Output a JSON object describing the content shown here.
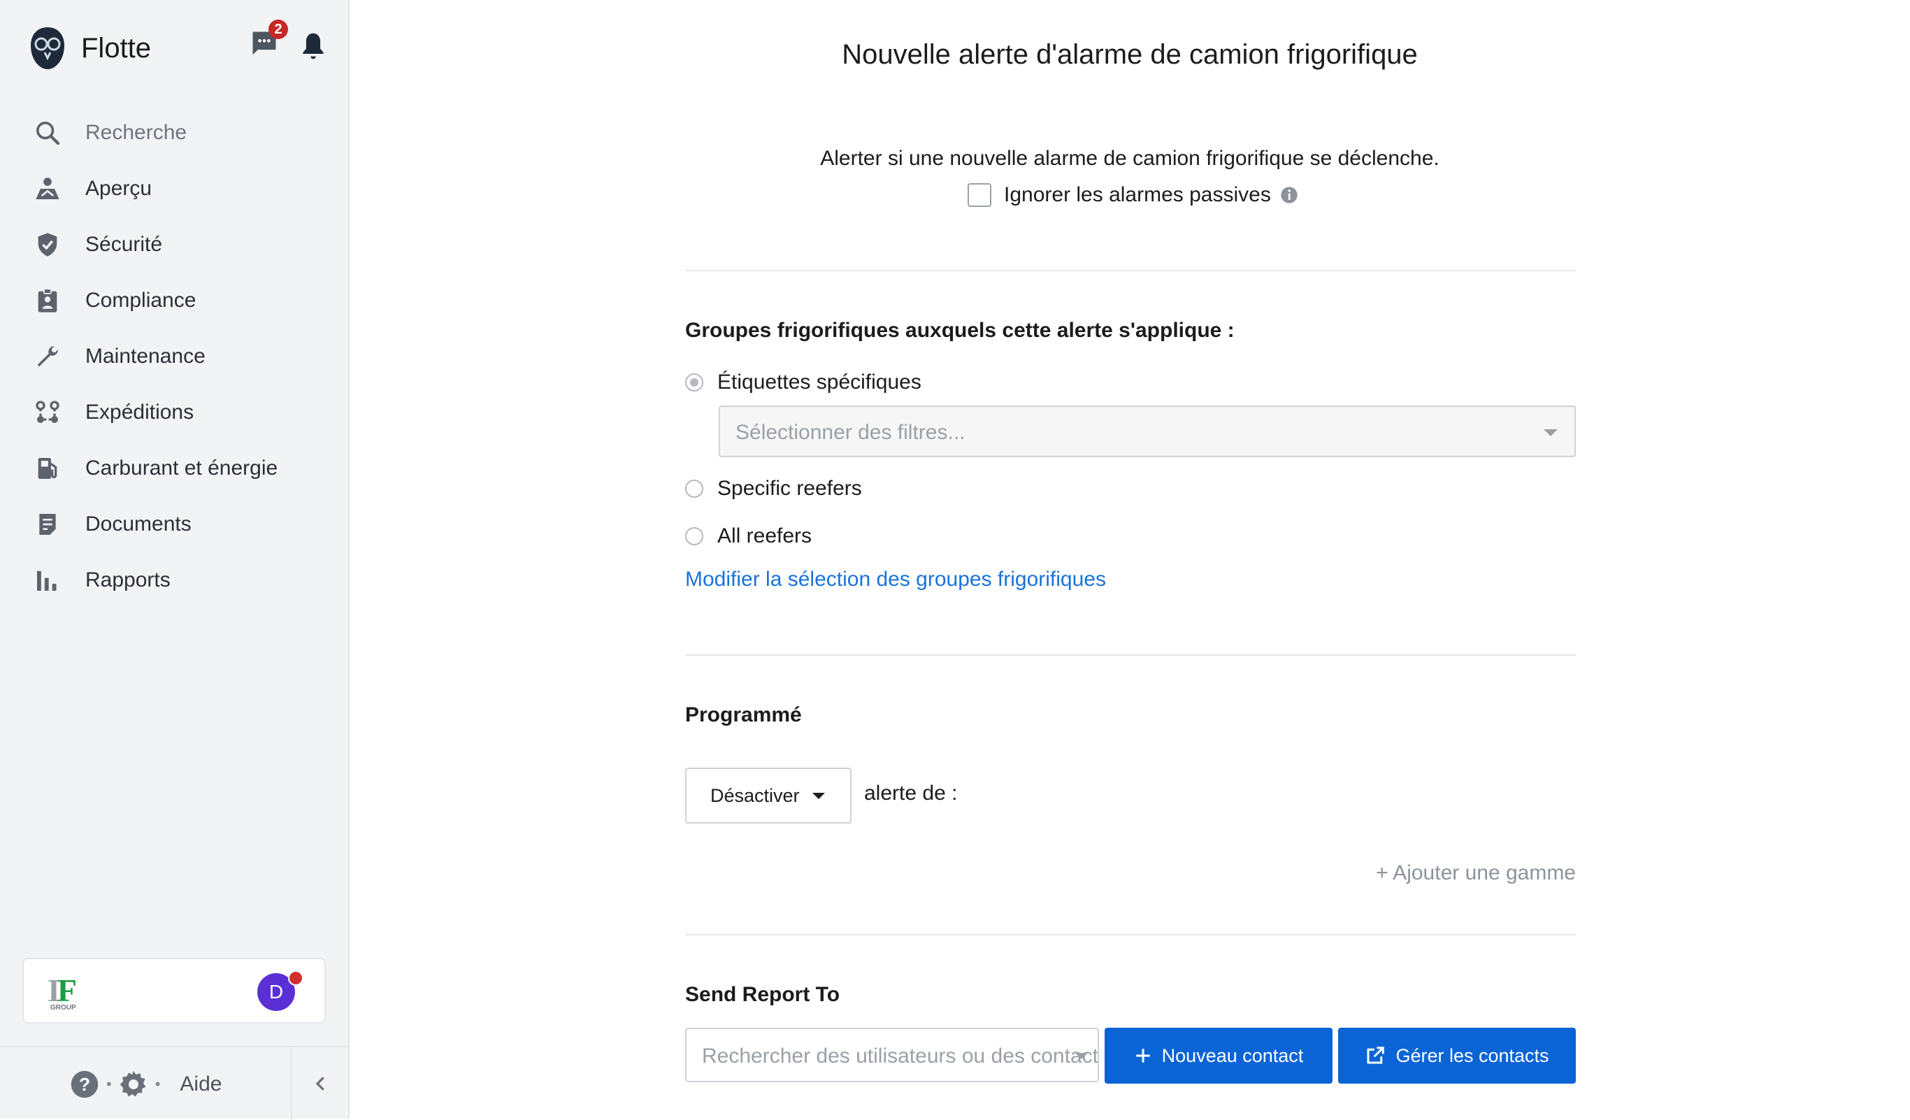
{
  "app": {
    "name": "Flotte"
  },
  "header": {
    "chat_badge_count": "2"
  },
  "search": {
    "label": "Recherche"
  },
  "nav": {
    "items": [
      {
        "label": "Aperçu",
        "icon": "map-person-icon"
      },
      {
        "label": "Sécurité",
        "icon": "shield-check-icon"
      },
      {
        "label": "Compliance",
        "icon": "clipboard-person-icon"
      },
      {
        "label": "Maintenance",
        "icon": "wrench-icon"
      },
      {
        "label": "Expéditions",
        "icon": "route-icon"
      },
      {
        "label": "Carburant et énergie",
        "icon": "fuel-pump-icon"
      },
      {
        "label": "Documents",
        "icon": "document-icon"
      },
      {
        "label": "Rapports",
        "icon": "bar-chart-icon"
      }
    ]
  },
  "org": {
    "avatar_initial": "D"
  },
  "footer": {
    "help_label": "Aide"
  },
  "page": {
    "title": "Nouvelle alerte d'alarme de camion frigorifique",
    "description": "Alerter si une nouvelle alarme de camion frigorifique se déclenche.",
    "ignore_passive_label": "Ignorer les alarmes passives"
  },
  "groups": {
    "title": "Groupes frigorifiques auxquels cette alerte s'applique :",
    "options": [
      {
        "label": "Étiquettes spécifiques",
        "selected": true
      },
      {
        "label": "Specific reefers",
        "selected": false
      },
      {
        "label": "All reefers",
        "selected": false
      }
    ],
    "filter_placeholder": "Sélectionner des filtres...",
    "modify_link": "Modifier la sélection des groupes frigorifiques"
  },
  "schedule": {
    "title": "Programmé",
    "dropdown_value": "Désactiver",
    "alert_of_label": "alerte de :",
    "add_range": "+ Ajouter une gamme"
  },
  "report": {
    "title": "Send Report To",
    "search_placeholder": "Rechercher des utilisateurs ou des contacts",
    "new_contact": "Nouveau contact",
    "manage_contacts": "Gérer les contacts"
  },
  "colors": {
    "primary": "#0a64d6",
    "link": "#1a73d9",
    "badge": "#c62828",
    "avatar": "#5b2fd6",
    "sidebar_bg": "#f2f3f5"
  }
}
